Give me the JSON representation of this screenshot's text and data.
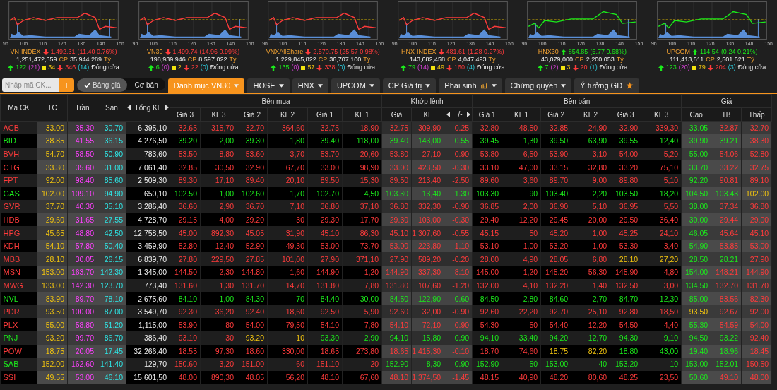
{
  "indices": [
    {
      "name": "VN-INDEX",
      "kind": "down",
      "value": "1,492.31",
      "change": "(11.40 0.76%)",
      "volume": "1,251,472,359",
      "cp_label": "CP",
      "amount": "35,944.289",
      "unit": "Tỷ",
      "up": "122",
      "ceiling": "(21)",
      "ref": "34",
      "down": "346",
      "floor": "(14)",
      "status": "Đóng cửa",
      "hours": [
        "9h",
        "10h",
        "11h",
        "12h",
        "13h",
        "14h",
        "15h"
      ]
    },
    {
      "name": "VN30",
      "kind": "down",
      "value": "1,499.74",
      "change": "(14.96 0.99%)",
      "volume": "198,939,946",
      "cp_label": "CP",
      "amount": "8,597.022",
      "unit": "Tỷ",
      "up": "6",
      "ceiling": "(0)",
      "ref": "2",
      "down": "22",
      "floor": "(0)",
      "status": "Đóng cửa",
      "hours": [
        "9h",
        "10h",
        "11h",
        "12h",
        "13h",
        "14h",
        "15h"
      ]
    },
    {
      "name": "VNXAllShare",
      "kind": "down",
      "value": "2,570.75",
      "change": "(25.57 0.98%)",
      "volume": "1,229,845,822",
      "cp_label": "CP",
      "amount": "36,707.100",
      "unit": "Tỷ",
      "up": "135",
      "ceiling": "(0)",
      "ref": "57",
      "down": "338",
      "floor": "(0)",
      "status": "Đóng cửa",
      "hours": [
        "9h",
        "10h",
        "11h",
        "12h",
        "13h",
        "14h",
        "15h"
      ]
    },
    {
      "name": "HNX-INDEX",
      "kind": "down",
      "value": "481.61",
      "change": "(1.28 0.27%)",
      "volume": "143,682,458",
      "cp_label": "CP",
      "amount": "4,047.493",
      "unit": "Tỷ",
      "up": "79",
      "ceiling": "(14)",
      "ref": "49",
      "down": "160",
      "floor": "(4)",
      "status": "Đóng cửa",
      "hours": [
        "9h",
        "10h",
        "11h",
        "12h",
        "13h",
        "14h",
        "15h"
      ]
    },
    {
      "name": "HNX30",
      "kind": "up",
      "value": "854.85",
      "change": "(5.77 0.68%)",
      "volume": "43,079,000",
      "cp_label": "CP",
      "amount": "2,200.053",
      "unit": "Tỷ",
      "up": "7",
      "ceiling": "(2)",
      "ref": "3",
      "down": "20",
      "floor": "(1)",
      "status": "Đóng cửa",
      "hours": [
        "9h",
        "10h",
        "11h",
        "12h",
        "13h",
        "14h",
        "15h"
      ]
    },
    {
      "name": "UPCOM",
      "kind": "up",
      "value": "114.54",
      "change": "(0.24 0.21%)",
      "volume": "111,413,511",
      "cp_label": "CP",
      "amount": "2,501.521",
      "unit": "Tỷ",
      "up": "123",
      "ceiling": "(20)",
      "ref": "79",
      "down": "204",
      "floor": "(3)",
      "status": "Đóng cửa",
      "hours": [
        "9h",
        "10h",
        "11h",
        "12h",
        "13h",
        "14h",
        "15h"
      ]
    }
  ],
  "toolbar": {
    "search": {
      "placeholder": "Nhập mã CK..."
    },
    "add_button": "+",
    "view_toggle": [
      {
        "label": "Bảng giá",
        "selected": true
      },
      {
        "label": "Cơ bản",
        "selected": false
      }
    ],
    "tabs": [
      {
        "label": "Danh mục VN30",
        "selected": true,
        "dropdown": true,
        "kind": "plain"
      },
      {
        "label": "HOSE",
        "selected": false,
        "dropdown": true,
        "kind": "plain"
      },
      {
        "label": "HNX",
        "selected": false,
        "dropdown": true,
        "kind": "plain"
      },
      {
        "label": "UPCOM",
        "selected": false,
        "dropdown": true,
        "kind": "plain"
      },
      {
        "label": "CP Giá trị",
        "selected": false,
        "dropdown": true,
        "kind": "plain"
      },
      {
        "label": "Phái sinh",
        "selected": false,
        "dropdown": true,
        "kind": "chart"
      },
      {
        "label": "Chứng quyền",
        "selected": false,
        "dropdown": true,
        "kind": "plain"
      },
      {
        "label": "Ý tưởng GD",
        "selected": false,
        "dropdown": false,
        "kind": "star"
      }
    ]
  },
  "header": {
    "fixed_columns": [
      {
        "label": "Mã CK",
        "arrows": false
      },
      {
        "label": "TC",
        "arrows": false
      },
      {
        "label": "Trần",
        "arrows": false
      },
      {
        "label": "Sàn",
        "arrows": false
      },
      {
        "label": "Tổng KL",
        "arrows": true
      }
    ],
    "groups": [
      {
        "title": "Bên mua",
        "columns": [
          {
            "label": "Giá 3",
            "arrows": false
          },
          {
            "label": "KL 3",
            "arrows": false
          },
          {
            "label": "Giá 2",
            "arrows": false
          },
          {
            "label": "KL 2",
            "arrows": false
          },
          {
            "label": "Giá 1",
            "arrows": false
          },
          {
            "label": "KL 1",
            "arrows": false
          }
        ]
      },
      {
        "title": "Khớp lệnh",
        "columns": [
          {
            "label": "Giá",
            "arrows": false
          },
          {
            "label": "KL",
            "arrows": false
          },
          {
            "label": "+/-",
            "arrows": true
          }
        ]
      },
      {
        "title": "Bên bán",
        "columns": [
          {
            "label": "Giá 1",
            "arrows": false
          },
          {
            "label": "KL 1",
            "arrows": false
          },
          {
            "label": "Giá 2",
            "arrows": false
          },
          {
            "label": "KL 2",
            "arrows": false
          },
          {
            "label": "Giá 3",
            "arrows": false
          },
          {
            "label": "KL 3",
            "arrows": false
          }
        ]
      },
      {
        "title": "Giá",
        "columns": [
          {
            "label": "Cao",
            "arrows": false
          },
          {
            "label": "TB",
            "arrows": false
          },
          {
            "label": "Thấp",
            "arrows": false
          }
        ]
      }
    ]
  },
  "rows": [
    {
      "symbol": "ACB",
      "kind": "down",
      "ref": "33.00",
      "ceiling": "35.30",
      "floor": "30.70",
      "total_volume": "6,395,10",
      "bid": [
        {
          "price": "32.65",
          "volume": "315,70",
          "kind": "down"
        },
        {
          "price": "32.70",
          "volume": "364,60",
          "kind": "down"
        },
        {
          "price": "32.75",
          "volume": "18,90",
          "kind": "down"
        }
      ],
      "match": {
        "price": "32.75",
        "volume": "309,90",
        "change": "-0.25",
        "kind": "down"
      },
      "ask": [
        {
          "price": "32.80",
          "volume": "48,50",
          "kind": "down"
        },
        {
          "price": "32.85",
          "volume": "24,90",
          "kind": "down"
        },
        {
          "price": "32.90",
          "volume": "339,30",
          "kind": "down"
        }
      ],
      "prices": [
        {
          "value": "33.05",
          "kind": "up"
        },
        {
          "value": "32.87",
          "kind": "down"
        },
        {
          "value": "32.70",
          "kind": "down"
        }
      ]
    },
    {
      "symbol": "BID",
      "kind": "up",
      "ref": "38.85",
      "ceiling": "41.55",
      "floor": "36.15",
      "total_volume": "4,276,50",
      "bid": [
        {
          "price": "39.20",
          "volume": "2,00",
          "kind": "up"
        },
        {
          "price": "39.30",
          "volume": "1,80",
          "kind": "up"
        },
        {
          "price": "39.40",
          "volume": "118,00",
          "kind": "up"
        }
      ],
      "match": {
        "price": "39.40",
        "volume": "143,00",
        "change": "0.55",
        "kind": "up"
      },
      "ask": [
        {
          "price": "39.45",
          "volume": "1,30",
          "kind": "up"
        },
        {
          "price": "39.50",
          "volume": "63,90",
          "kind": "up"
        },
        {
          "price": "39.55",
          "volume": "12,40",
          "kind": "up"
        }
      ],
      "prices": [
        {
          "value": "39.90",
          "kind": "up"
        },
        {
          "value": "39.21",
          "kind": "up"
        },
        {
          "value": "38.30",
          "kind": "down"
        }
      ]
    },
    {
      "symbol": "BVH",
      "kind": "down",
      "ref": "54.70",
      "ceiling": "58.50",
      "floor": "50.90",
      "total_volume": "783,60",
      "bid": [
        {
          "price": "53.50",
          "volume": "8,80",
          "kind": "down"
        },
        {
          "price": "53.60",
          "volume": "3,70",
          "kind": "down"
        },
        {
          "price": "53.70",
          "volume": "20,60",
          "kind": "down"
        }
      ],
      "match": {
        "price": "53.80",
        "volume": "27,10",
        "change": "-0.90",
        "kind": "down"
      },
      "ask": [
        {
          "price": "53.80",
          "volume": "6,50",
          "kind": "down"
        },
        {
          "price": "53.90",
          "volume": "3,10",
          "kind": "down"
        },
        {
          "price": "54.00",
          "volume": "5,20",
          "kind": "down"
        }
      ],
      "prices": [
        {
          "value": "55.00",
          "kind": "up"
        },
        {
          "value": "54.06",
          "kind": "down"
        },
        {
          "value": "52.80",
          "kind": "down"
        }
      ]
    },
    {
      "symbol": "CTG",
      "kind": "down",
      "ref": "33.30",
      "ceiling": "35.60",
      "floor": "31.00",
      "total_volume": "7,061,40",
      "bid": [
        {
          "price": "32.85",
          "volume": "30,50",
          "kind": "down"
        },
        {
          "price": "32.90",
          "volume": "67,70",
          "kind": "down"
        },
        {
          "price": "33.00",
          "volume": "98,90",
          "kind": "down"
        }
      ],
      "match": {
        "price": "33.00",
        "volume": "423,50",
        "change": "-0.30",
        "kind": "down"
      },
      "ask": [
        {
          "price": "33.10",
          "volume": "47,00",
          "kind": "down"
        },
        {
          "price": "33.15",
          "volume": "32,80",
          "kind": "down"
        },
        {
          "price": "33.20",
          "volume": "75,10",
          "kind": "down"
        }
      ],
      "prices": [
        {
          "value": "33.70",
          "kind": "up"
        },
        {
          "value": "33.22",
          "kind": "down"
        },
        {
          "value": "32.75",
          "kind": "down"
        }
      ]
    },
    {
      "symbol": "FPT",
      "kind": "down",
      "ref": "92.00",
      "ceiling": "98.40",
      "floor": "85.60",
      "total_volume": "2,509,30",
      "bid": [
        {
          "price": "89.30",
          "volume": "17,10",
          "kind": "down"
        },
        {
          "price": "89.40",
          "volume": "20,10",
          "kind": "down"
        },
        {
          "price": "89.50",
          "volume": "15,30",
          "kind": "down"
        }
      ],
      "match": {
        "price": "89.50",
        "volume": "213,40",
        "change": "-2.50",
        "kind": "down"
      },
      "ask": [
        {
          "price": "89.60",
          "volume": "3,60",
          "kind": "down"
        },
        {
          "price": "89.70",
          "volume": "9,00",
          "kind": "down"
        },
        {
          "price": "89.80",
          "volume": "5,10",
          "kind": "down"
        }
      ],
      "prices": [
        {
          "value": "92.20",
          "kind": "up"
        },
        {
          "value": "90.81",
          "kind": "down"
        },
        {
          "value": "89.10",
          "kind": "down"
        }
      ]
    },
    {
      "symbol": "GAS",
      "kind": "up",
      "ref": "102.00",
      "ceiling": "109.10",
      "floor": "94.90",
      "total_volume": "650,10",
      "bid": [
        {
          "price": "102.50",
          "volume": "1,00",
          "kind": "up"
        },
        {
          "price": "102.60",
          "volume": "1,70",
          "kind": "up"
        },
        {
          "price": "102.70",
          "volume": "4,50",
          "kind": "up"
        }
      ],
      "match": {
        "price": "103.30",
        "volume": "13,40",
        "change": "1.30",
        "kind": "up"
      },
      "ask": [
        {
          "price": "103.30",
          "volume": "90",
          "kind": "up"
        },
        {
          "price": "103.40",
          "volume": "2,20",
          "kind": "up"
        },
        {
          "price": "103.50",
          "volume": "18,20",
          "kind": "up"
        }
      ],
      "prices": [
        {
          "value": "104.50",
          "kind": "up"
        },
        {
          "value": "103.43",
          "kind": "up"
        },
        {
          "value": "102.00",
          "kind": "ref"
        }
      ]
    },
    {
      "symbol": "GVR",
      "kind": "down",
      "ref": "37.70",
      "ceiling": "40.30",
      "floor": "35.10",
      "total_volume": "3,286,40",
      "bid": [
        {
          "price": "36.60",
          "volume": "2,90",
          "kind": "down"
        },
        {
          "price": "36.70",
          "volume": "7,10",
          "kind": "down"
        },
        {
          "price": "36.80",
          "volume": "37,10",
          "kind": "down"
        }
      ],
      "match": {
        "price": "36.80",
        "volume": "332,30",
        "change": "-0.90",
        "kind": "down"
      },
      "ask": [
        {
          "price": "36.85",
          "volume": "2,00",
          "kind": "down"
        },
        {
          "price": "36.90",
          "volume": "5,10",
          "kind": "down"
        },
        {
          "price": "36.95",
          "volume": "5,50",
          "kind": "down"
        }
      ],
      "prices": [
        {
          "value": "38.00",
          "kind": "up"
        },
        {
          "value": "37.34",
          "kind": "down"
        },
        {
          "value": "36.80",
          "kind": "down"
        }
      ]
    },
    {
      "symbol": "HDB",
      "kind": "down",
      "ref": "29.60",
      "ceiling": "31.65",
      "floor": "27.55",
      "total_volume": "4,728,70",
      "bid": [
        {
          "price": "29.15",
          "volume": "4,00",
          "kind": "down"
        },
        {
          "price": "29.20",
          "volume": "30",
          "kind": "down"
        },
        {
          "price": "29.30",
          "volume": "17,70",
          "kind": "down"
        }
      ],
      "match": {
        "price": "29.30",
        "volume": "103,00",
        "change": "-0.30",
        "kind": "down"
      },
      "ask": [
        {
          "price": "29.40",
          "volume": "12,20",
          "kind": "down"
        },
        {
          "price": "29.45",
          "volume": "20,00",
          "kind": "down"
        },
        {
          "price": "29.50",
          "volume": "36,40",
          "kind": "down"
        }
      ],
      "prices": [
        {
          "value": "30.00",
          "kind": "up"
        },
        {
          "value": "29.44",
          "kind": "down"
        },
        {
          "value": "29.00",
          "kind": "down"
        }
      ]
    },
    {
      "symbol": "HPG",
      "kind": "down",
      "ref": "45.65",
      "ceiling": "48.80",
      "floor": "42.50",
      "total_volume": "12,758,50",
      "bid": [
        {
          "price": "45.00",
          "volume": "892,30",
          "kind": "down"
        },
        {
          "price": "45.05",
          "volume": "31,90",
          "kind": "down"
        },
        {
          "price": "45.10",
          "volume": "86,30",
          "kind": "down"
        }
      ],
      "match": {
        "price": "45.10",
        "volume": "1,307,60",
        "change": "-0.55",
        "kind": "down"
      },
      "ask": [
        {
          "price": "45.15",
          "volume": "50",
          "kind": "down"
        },
        {
          "price": "45.20",
          "volume": "1,00",
          "kind": "down"
        },
        {
          "price": "45.25",
          "volume": "24,10",
          "kind": "down"
        }
      ],
      "prices": [
        {
          "value": "46.05",
          "kind": "up"
        },
        {
          "value": "45.64",
          "kind": "down"
        },
        {
          "value": "45.10",
          "kind": "down"
        }
      ]
    },
    {
      "symbol": "KDH",
      "kind": "down",
      "ref": "54.10",
      "ceiling": "57.80",
      "floor": "50.40",
      "total_volume": "3,459,90",
      "bid": [
        {
          "price": "52.80",
          "volume": "12,40",
          "kind": "down"
        },
        {
          "price": "52.90",
          "volume": "49,30",
          "kind": "down"
        },
        {
          "price": "53.00",
          "volume": "73,70",
          "kind": "down"
        }
      ],
      "match": {
        "price": "53.00",
        "volume": "223,80",
        "change": "-1.10",
        "kind": "down"
      },
      "ask": [
        {
          "price": "53.10",
          "volume": "1,00",
          "kind": "down"
        },
        {
          "price": "53.20",
          "volume": "1,00",
          "kind": "down"
        },
        {
          "price": "53.30",
          "volume": "3,40",
          "kind": "down"
        }
      ],
      "prices": [
        {
          "value": "54.90",
          "kind": "up"
        },
        {
          "value": "53.85",
          "kind": "down"
        },
        {
          "value": "53.00",
          "kind": "down"
        }
      ]
    },
    {
      "symbol": "MBB",
      "kind": "down",
      "ref": "28.10",
      "ceiling": "30.05",
      "floor": "26.15",
      "total_volume": "6,839,70",
      "bid": [
        {
          "price": "27.80",
          "volume": "229,50",
          "kind": "down"
        },
        {
          "price": "27.85",
          "volume": "101,00",
          "kind": "down"
        },
        {
          "price": "27.90",
          "volume": "371,10",
          "kind": "down"
        }
      ],
      "match": {
        "price": "27.90",
        "volume": "589,20",
        "change": "-0.20",
        "kind": "down"
      },
      "ask": [
        {
          "price": "28.00",
          "volume": "4,90",
          "kind": "down"
        },
        {
          "price": "28.05",
          "volume": "6,80",
          "kind": "down"
        },
        {
          "price": "28.10",
          "volume": "27,20",
          "kind": "ref"
        }
      ],
      "prices": [
        {
          "value": "28.50",
          "kind": "up"
        },
        {
          "value": "28.21",
          "kind": "up"
        },
        {
          "value": "27.90",
          "kind": "down"
        }
      ]
    },
    {
      "symbol": "MSN",
      "kind": "down",
      "ref": "153.00",
      "ceiling": "163.70",
      "floor": "142.30",
      "total_volume": "1,345,00",
      "bid": [
        {
          "price": "144.50",
          "volume": "2,30",
          "kind": "down"
        },
        {
          "price": "144.80",
          "volume": "1,60",
          "kind": "down"
        },
        {
          "price": "144.90",
          "volume": "1,20",
          "kind": "down"
        }
      ],
      "match": {
        "price": "144.90",
        "volume": "337,30",
        "change": "-8.10",
        "kind": "down"
      },
      "ask": [
        {
          "price": "145.00",
          "volume": "1,20",
          "kind": "down"
        },
        {
          "price": "145.20",
          "volume": "56,30",
          "kind": "down"
        },
        {
          "price": "145.90",
          "volume": "4,80",
          "kind": "down"
        }
      ],
      "prices": [
        {
          "value": "154.00",
          "kind": "up"
        },
        {
          "value": "148.21",
          "kind": "down"
        },
        {
          "value": "144.90",
          "kind": "down"
        }
      ]
    },
    {
      "symbol": "MWG",
      "kind": "down",
      "ref": "133.00",
      "ceiling": "142.30",
      "floor": "123.70",
      "total_volume": "773,40",
      "bid": [
        {
          "price": "131.60",
          "volume": "1,30",
          "kind": "down"
        },
        {
          "price": "131.70",
          "volume": "14,70",
          "kind": "down"
        },
        {
          "price": "131.80",
          "volume": "7,80",
          "kind": "down"
        }
      ],
      "match": {
        "price": "131.80",
        "volume": "107,60",
        "change": "-1.20",
        "kind": "down"
      },
      "ask": [
        {
          "price": "132.00",
          "volume": "4,10",
          "kind": "down"
        },
        {
          "price": "132.20",
          "volume": "1,40",
          "kind": "down"
        },
        {
          "price": "132.50",
          "volume": "3,00",
          "kind": "down"
        }
      ],
      "prices": [
        {
          "value": "134.50",
          "kind": "up"
        },
        {
          "value": "132.70",
          "kind": "down"
        },
        {
          "value": "131.70",
          "kind": "down"
        }
      ]
    },
    {
      "symbol": "NVL",
      "kind": "up",
      "ref": "83.90",
      "ceiling": "89.70",
      "floor": "78.10",
      "total_volume": "2,675,60",
      "bid": [
        {
          "price": "84.10",
          "volume": "1,00",
          "kind": "up"
        },
        {
          "price": "84.30",
          "volume": "70",
          "kind": "up"
        },
        {
          "price": "84.40",
          "volume": "30,00",
          "kind": "up"
        }
      ],
      "match": {
        "price": "84.50",
        "volume": "122,90",
        "change": "0.60",
        "kind": "up"
      },
      "ask": [
        {
          "price": "84.50",
          "volume": "2,80",
          "kind": "up"
        },
        {
          "price": "84.60",
          "volume": "2,70",
          "kind": "up"
        },
        {
          "price": "84.70",
          "volume": "12,30",
          "kind": "up"
        }
      ],
      "prices": [
        {
          "value": "85.00",
          "kind": "up"
        },
        {
          "value": "83.56",
          "kind": "down"
        },
        {
          "value": "82.30",
          "kind": "down"
        }
      ]
    },
    {
      "symbol": "PDR",
      "kind": "down",
      "ref": "93.50",
      "ceiling": "100.00",
      "floor": "87.00",
      "total_volume": "3,549,70",
      "bid": [
        {
          "price": "92.30",
          "volume": "36,20",
          "kind": "down"
        },
        {
          "price": "92.40",
          "volume": "18,60",
          "kind": "down"
        },
        {
          "price": "92.50",
          "volume": "5,90",
          "kind": "down"
        }
      ],
      "match": {
        "price": "92.60",
        "volume": "32,00",
        "change": "-0.90",
        "kind": "down"
      },
      "ask": [
        {
          "price": "92.60",
          "volume": "22,20",
          "kind": "down"
        },
        {
          "price": "92.70",
          "volume": "25,10",
          "kind": "down"
        },
        {
          "price": "92.80",
          "volume": "18,50",
          "kind": "down"
        }
      ],
      "prices": [
        {
          "value": "93.50",
          "kind": "ref"
        },
        {
          "value": "92.67",
          "kind": "down"
        },
        {
          "value": "92.00",
          "kind": "down"
        }
      ]
    },
    {
      "symbol": "PLX",
      "kind": "down",
      "ref": "55.00",
      "ceiling": "58.80",
      "floor": "51.20",
      "total_volume": "1,115,00",
      "bid": [
        {
          "price": "53.90",
          "volume": "80",
          "kind": "down"
        },
        {
          "price": "54.00",
          "volume": "79,50",
          "kind": "down"
        },
        {
          "price": "54.10",
          "volume": "7,80",
          "kind": "down"
        }
      ],
      "match": {
        "price": "54.10",
        "volume": "72,10",
        "change": "-0.90",
        "kind": "down"
      },
      "ask": [
        {
          "price": "54.30",
          "volume": "50",
          "kind": "down"
        },
        {
          "price": "54.40",
          "volume": "12,20",
          "kind": "down"
        },
        {
          "price": "54.50",
          "volume": "4,40",
          "kind": "down"
        }
      ],
      "prices": [
        {
          "value": "55.30",
          "kind": "up"
        },
        {
          "value": "54.59",
          "kind": "down"
        },
        {
          "value": "54.00",
          "kind": "down"
        }
      ]
    },
    {
      "symbol": "PNJ",
      "kind": "up",
      "ref": "93.20",
      "ceiling": "99.70",
      "floor": "86.70",
      "total_volume": "386,40",
      "bid": [
        {
          "price": "93.10",
          "volume": "30",
          "kind": "down"
        },
        {
          "price": "93.20",
          "volume": "10",
          "kind": "ref"
        },
        {
          "price": "93.30",
          "volume": "2,90",
          "kind": "up"
        }
      ],
      "match": {
        "price": "94.10",
        "volume": "15,80",
        "change": "0.90",
        "kind": "up"
      },
      "ask": [
        {
          "price": "94.10",
          "volume": "33,40",
          "kind": "up"
        },
        {
          "price": "94.20",
          "volume": "12,70",
          "kind": "up"
        },
        {
          "price": "94.30",
          "volume": "9,10",
          "kind": "up"
        }
      ],
      "prices": [
        {
          "value": "94.50",
          "kind": "up"
        },
        {
          "value": "93.22",
          "kind": "up"
        },
        {
          "value": "92.40",
          "kind": "down"
        }
      ]
    },
    {
      "symbol": "POW",
      "kind": "down",
      "ref": "18.75",
      "ceiling": "20.05",
      "floor": "17.45",
      "total_volume": "32,266,40",
      "bid": [
        {
          "price": "18.55",
          "volume": "97,30",
          "kind": "down"
        },
        {
          "price": "18.60",
          "volume": "330,00",
          "kind": "down"
        },
        {
          "price": "18.65",
          "volume": "273,80",
          "kind": "down"
        }
      ],
      "match": {
        "price": "18.65",
        "volume": "1,415,30",
        "change": "-0.10",
        "kind": "down"
      },
      "ask": [
        {
          "price": "18.70",
          "volume": "74,60",
          "kind": "down"
        },
        {
          "price": "18.75",
          "volume": "82,20",
          "kind": "ref"
        },
        {
          "price": "18.80",
          "volume": "43,00",
          "kind": "up"
        }
      ],
      "prices": [
        {
          "value": "19.40",
          "kind": "up"
        },
        {
          "value": "18.96",
          "kind": "up"
        },
        {
          "value": "18.45",
          "kind": "down"
        }
      ]
    },
    {
      "symbol": "SAB",
      "kind": "up",
      "ref": "152.00",
      "ceiling": "162.60",
      "floor": "141.40",
      "total_volume": "129,70",
      "bid": [
        {
          "price": "150.60",
          "volume": "3,20",
          "kind": "down"
        },
        {
          "price": "151.00",
          "volume": "60",
          "kind": "down"
        },
        {
          "price": "151.10",
          "volume": "20",
          "kind": "down"
        }
      ],
      "match": {
        "price": "152.90",
        "volume": "8,30",
        "change": "0.90",
        "kind": "up"
      },
      "ask": [
        {
          "price": "152.90",
          "volume": "50",
          "kind": "up"
        },
        {
          "price": "153.00",
          "volume": "40",
          "kind": "up"
        },
        {
          "price": "153.20",
          "volume": "10",
          "kind": "up"
        }
      ],
      "prices": [
        {
          "value": "153.00",
          "kind": "up"
        },
        {
          "value": "152.01",
          "kind": "up"
        },
        {
          "value": "150.50",
          "kind": "down"
        }
      ]
    },
    {
      "symbol": "SSI",
      "kind": "down",
      "ref": "49.55",
      "ceiling": "53.00",
      "floor": "46.10",
      "total_volume": "15,601,50",
      "bid": [
        {
          "price": "48.00",
          "volume": "890,30",
          "kind": "down"
        },
        {
          "price": "48.05",
          "volume": "56,20",
          "kind": "down"
        },
        {
          "price": "48.10",
          "volume": "67,60",
          "kind": "down"
        }
      ],
      "match": {
        "price": "48.10",
        "volume": "1,374,50",
        "change": "-1.45",
        "kind": "down"
      },
      "ask": [
        {
          "price": "48.15",
          "volume": "40,90",
          "kind": "down"
        },
        {
          "price": "48.20",
          "volume": "80,60",
          "kind": "down"
        },
        {
          "price": "48.25",
          "volume": "23,50",
          "kind": "down"
        }
      ],
      "prices": [
        {
          "value": "50.60",
          "kind": "up"
        },
        {
          "value": "49.10",
          "kind": "down"
        },
        {
          "value": "48.00",
          "kind": "down"
        }
      ]
    }
  ]
}
